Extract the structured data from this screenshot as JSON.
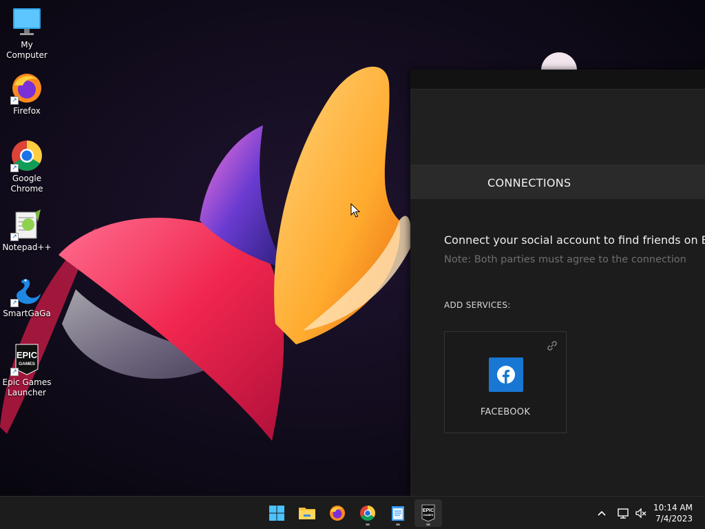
{
  "desktop": {
    "icons": [
      {
        "label": "My Computer"
      },
      {
        "label": "Firefox"
      },
      {
        "label": "Google Chrome"
      },
      {
        "label": "Notepad++"
      },
      {
        "label": "SmartGaGa"
      },
      {
        "label": "Epic Games Launcher"
      }
    ]
  },
  "epic": {
    "tab_label": "CONNECTIONS",
    "heading": "Connect your social account to find friends on E",
    "note": "Note: Both parties must agree to the connection",
    "add_services_label": "ADD SERVICES:",
    "facebook_label": "FACEBOOK",
    "epic_logo_top": "EPIC",
    "epic_logo_bottom": "GAMES"
  },
  "taskbar": {
    "time": "10:14 AM",
    "date": "7/4/2023"
  },
  "colors": {
    "facebook_blue": "#1877d2",
    "window_bg": "#202020",
    "taskbar_bg": "#1c1c1c"
  }
}
